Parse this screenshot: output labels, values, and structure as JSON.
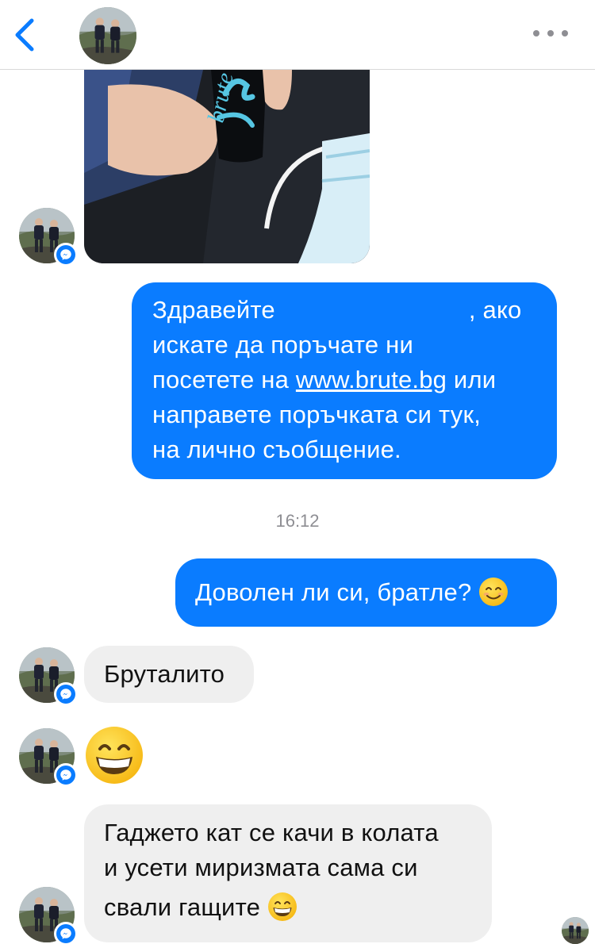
{
  "header": {
    "back_icon": "chevron-left-icon",
    "contact_avatar": "contact-avatar",
    "more_icon": "more-dots-icon"
  },
  "colors": {
    "accent": "#0a7cff",
    "incoming_bubble": "#efefef",
    "timestamp": "#8e8e93"
  },
  "messages": [
    {
      "type": "image",
      "direction": "incoming",
      "photo_text": "brute"
    },
    {
      "type": "text",
      "direction": "outgoing",
      "line1_start": "Здравейте",
      "line1_end": ", ако",
      "line2": "искате да поръчате ни",
      "line3_start": "посетете на ",
      "link": "www.brute.bg",
      "line3_end": " или",
      "line4": "направете поръчката си тук,",
      "line5": "на лично съобщение."
    },
    {
      "type": "timestamp",
      "text": "16:12"
    },
    {
      "type": "text",
      "direction": "outgoing",
      "text": "Доволен ли си, братле?",
      "emoji": "smiling-face-icon"
    },
    {
      "type": "text",
      "direction": "incoming",
      "text": "Бруталито"
    },
    {
      "type": "emoji",
      "direction": "incoming",
      "emoji": "grinning-face-icon"
    },
    {
      "type": "text",
      "direction": "incoming",
      "line1": "Гаджето кат се качи в колата",
      "line2": "и усети миризмата сама си",
      "line3": "свали гащите",
      "emoji": "grinning-face-icon"
    }
  ]
}
